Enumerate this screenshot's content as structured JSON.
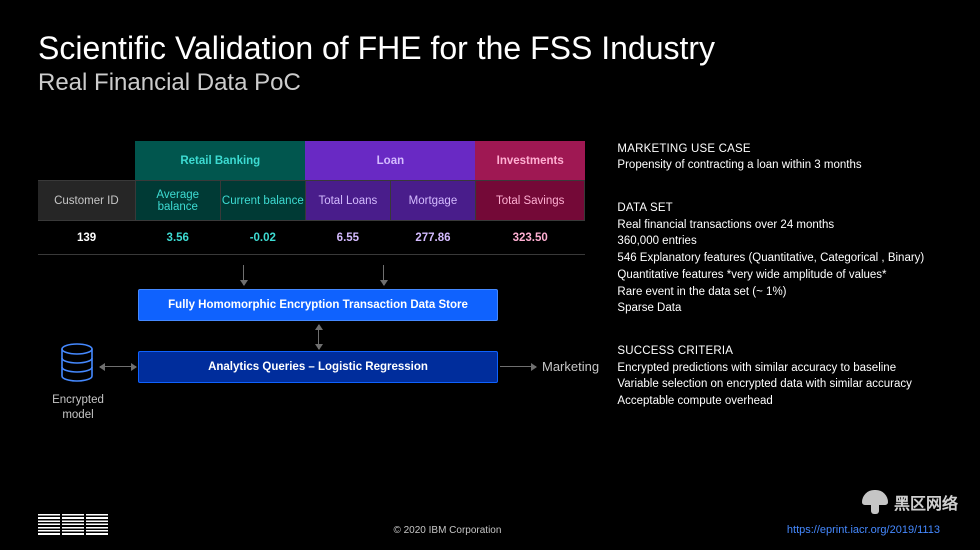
{
  "title": "Scientific Validation of FHE for the FSS Industry",
  "subtitle": "Real Financial Data PoC",
  "categories": {
    "retail": "Retail Banking",
    "loan": "Loan",
    "investments": "Investments"
  },
  "columns": {
    "customer": "Customer ID",
    "avg": "Average balance",
    "current": "Current balance",
    "total_loans": "Total Loans",
    "mortgage": "Mortgage",
    "savings": "Total Savings"
  },
  "row": {
    "customer": "139",
    "avg": "3.56",
    "current": "-0.02",
    "total_loans": "6.55",
    "mortgage": "277.86",
    "savings": "323.50"
  },
  "diagram": {
    "box1": "Fully Homomorphic Encryption Transaction Data Store",
    "box2": "Analytics Queries – Logistic Regression",
    "db_label": "Encrypted model",
    "marketing": "Marketing"
  },
  "sections": {
    "marketing": {
      "title": "MARKETING USE CASE",
      "lines": [
        "Propensity of contracting a loan within 3 months"
      ]
    },
    "dataset": {
      "title": "DATA SET",
      "lines": [
        "Real financial transactions over 24 months",
        "360,000 entries",
        "546 Explanatory features (Quantitative, Categorical , Binary)",
        "Quantitative features *very  wide amplitude of values*",
        "Rare event in the data set (~ 1%)",
        "Sparse Data"
      ]
    },
    "success": {
      "title": "SUCCESS CRITERIA",
      "lines": [
        "Encrypted predictions with similar accuracy to baseline",
        "Variable selection on encrypted data with similar accuracy",
        "Acceptable compute overhead"
      ]
    }
  },
  "footer": {
    "copyright": "© 2020 IBM Corporation",
    "url": "https://eprint.iacr.org/2019/1113"
  },
  "watermark": "黑区网络"
}
